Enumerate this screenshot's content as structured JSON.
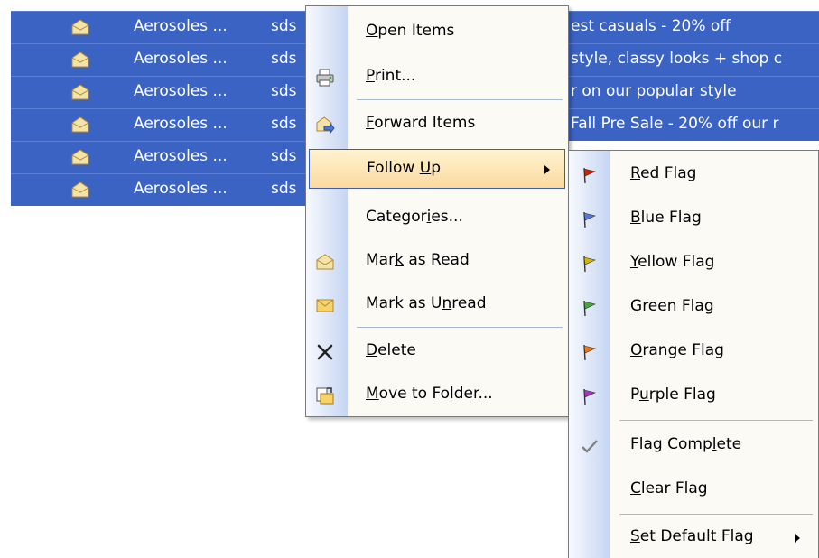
{
  "email_rows": [
    {
      "from": "Aerosoles ...",
      "to": "sds",
      "subject": "est casuals - 20% off"
    },
    {
      "from": "Aerosoles ...",
      "to": "sds",
      "subject": "style, classy looks + shop c"
    },
    {
      "from": "Aerosoles ...",
      "to": "sds",
      "subject": "r on our popular style"
    },
    {
      "from": "Aerosoles ...",
      "to": "sds",
      "subject": "Fall Pre Sale - 20% off our r"
    },
    {
      "from": "Aerosoles ...",
      "to": "sds",
      "subject": ""
    },
    {
      "from": "Aerosoles ...",
      "to": "sds",
      "subject": ""
    }
  ],
  "context_menu": {
    "items": [
      {
        "pre": "",
        "key": "O",
        "post": "pen Items",
        "icon": "none"
      },
      {
        "pre": "",
        "key": "P",
        "post": "rint...",
        "icon": "printer-icon"
      },
      {
        "pre": "",
        "key": "F",
        "post": "orward Items",
        "icon": "forward-icon"
      },
      {
        "pre": "Follow ",
        "key": "U",
        "post": "p",
        "icon": "none"
      },
      {
        "pre": "Categor",
        "key": "i",
        "post": "es...",
        "icon": "none"
      },
      {
        "pre": "Mar",
        "key": "k",
        "post": " as Read",
        "icon": "read-envelope-icon"
      },
      {
        "pre": "Mark as U",
        "key": "n",
        "post": "read",
        "icon": "unread-envelope-icon"
      },
      {
        "pre": "",
        "key": "D",
        "post": "elete",
        "icon": "delete-icon"
      },
      {
        "pre": "",
        "key": "M",
        "post": "ove to Folder...",
        "icon": "move-folder-icon"
      }
    ]
  },
  "follow_up_menu": {
    "items": [
      {
        "pre": "",
        "key": "R",
        "post": "ed Flag",
        "color": "#cc2200"
      },
      {
        "pre": "",
        "key": "B",
        "post": "lue Flag",
        "color": "#5577dd"
      },
      {
        "pre": "",
        "key": "Y",
        "post": "ellow Flag",
        "color": "#d9b400"
      },
      {
        "pre": "",
        "key": "G",
        "post": "reen Flag",
        "color": "#44aa33"
      },
      {
        "pre": "",
        "key": "O",
        "post": "range Flag",
        "color": "#ee7711"
      },
      {
        "pre": "P",
        "key": "u",
        "post": "rple Flag",
        "color": "#aa33bb"
      },
      {
        "pre": "Flag Comp",
        "key": "l",
        "post": "ete",
        "color": "#808080"
      },
      {
        "pre": "",
        "key": "C",
        "post": "lear Flag",
        "color": ""
      },
      {
        "pre": "",
        "key": "S",
        "post": "et Default Flag",
        "color": ""
      }
    ]
  }
}
